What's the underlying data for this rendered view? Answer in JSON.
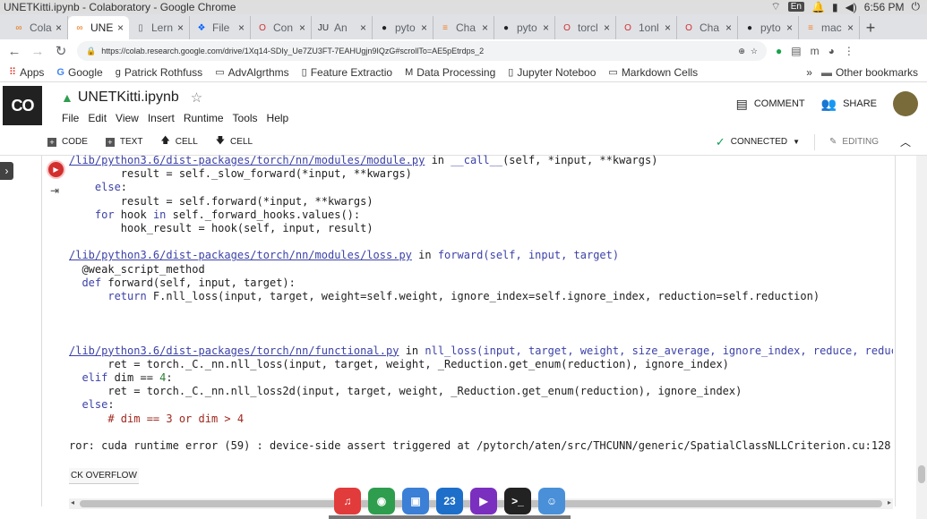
{
  "os": {
    "window_title": "UNETKitti.ipynb - Colaboratory - Google Chrome",
    "lang": "En",
    "clock": "6:56 PM"
  },
  "tabs": [
    {
      "icon": "colab",
      "label": "Cola",
      "active": false
    },
    {
      "icon": "colab",
      "label": "UNE",
      "active": true
    },
    {
      "icon": "doc",
      "label": "Lern",
      "active": false
    },
    {
      "icon": "dropbox",
      "label": "File",
      "active": false
    },
    {
      "icon": "opera",
      "label": "Con",
      "active": false
    },
    {
      "icon": "jupyter",
      "label": "An",
      "active": false
    },
    {
      "icon": "github",
      "label": "pyto",
      "active": false
    },
    {
      "icon": "stack",
      "label": "Cha",
      "active": false
    },
    {
      "icon": "github",
      "label": "pyto",
      "active": false
    },
    {
      "icon": "opera",
      "label": "torcl",
      "active": false
    },
    {
      "icon": "opera",
      "label": "1onl",
      "active": false
    },
    {
      "icon": "opera",
      "label": "Cha",
      "active": false
    },
    {
      "icon": "github",
      "label": "pyto",
      "active": false
    },
    {
      "icon": "stack",
      "label": "mac",
      "active": false
    }
  ],
  "address": {
    "url": "https://colab.research.google.com/drive/1Xq14-SDIy_Ue7ZU3FT-7EAHUgjn9IQzG#scrollTo=AE5pEtrdps_2"
  },
  "bookmarks": [
    {
      "icon": "apps",
      "label": "Apps"
    },
    {
      "icon": "google",
      "label": "Google"
    },
    {
      "icon": "g",
      "label": "Patrick Rothfuss"
    },
    {
      "icon": "box",
      "label": "AdvAlgrthms"
    },
    {
      "icon": "doc",
      "label": "Feature Extractio"
    },
    {
      "icon": "m",
      "label": "Data Processing"
    },
    {
      "icon": "doc",
      "label": "Jupyter Noteboo"
    },
    {
      "icon": "box",
      "label": "Markdown Cells"
    }
  ],
  "bookmarks_more": "»",
  "other_bookmarks": "Other bookmarks",
  "colab": {
    "logo": "CO",
    "notebook_title": "UNETKitti.ipynb",
    "menu": [
      "File",
      "Edit",
      "View",
      "Insert",
      "Runtime",
      "Tools",
      "Help"
    ],
    "comment": "COMMENT",
    "share": "SHARE"
  },
  "toolbar": {
    "code": "CODE",
    "text": "TEXT",
    "cell_up": "CELL",
    "cell_down": "CELL",
    "connected": "CONNECTED",
    "editing": "EDITING"
  },
  "output": {
    "lines": [
      [
        {
          "c": "lnk",
          "t": "/lib/python3.6/dist-packages/torch/nn/modules/module.py"
        },
        {
          "c": "",
          "t": " in "
        },
        {
          "c": "fn",
          "t": "__call__"
        },
        {
          "c": "",
          "t": "(self, *input, **kwargs)"
        }
      ],
      [
        {
          "c": "",
          "t": "        result = self._slow_forward(*input, **kwargs)"
        }
      ],
      [
        {
          "c": "kw",
          "t": "    else"
        },
        {
          "c": "",
          "t": ":"
        }
      ],
      [
        {
          "c": "",
          "t": "        result = self.forward(*input, **kwargs)"
        }
      ],
      [
        {
          "c": "kw",
          "t": "    for"
        },
        {
          "c": "",
          "t": " hook "
        },
        {
          "c": "kw",
          "t": "in"
        },
        {
          "c": "",
          "t": " self._forward_hooks.values():"
        }
      ],
      [
        {
          "c": "",
          "t": "        hook_result = hook(self, input, result)"
        }
      ],
      [
        {
          "c": "",
          "t": ""
        }
      ],
      [
        {
          "c": "lnk",
          "t": "/lib/python3.6/dist-packages/torch/nn/modules/loss.py"
        },
        {
          "c": "",
          "t": " in "
        },
        {
          "c": "fn",
          "t": "forward(self, input, target)"
        }
      ],
      [
        {
          "c": "",
          "t": "  @weak_script_method"
        }
      ],
      [
        {
          "c": "kw",
          "t": "  def"
        },
        {
          "c": "",
          "t": " forward(self, input, target):"
        }
      ],
      [
        {
          "c": "kw",
          "t": "      return"
        },
        {
          "c": "",
          "t": " F.nll_loss(input, target, weight=self.weight, ignore_index=self.ignore_index, reduction=self.reduction)"
        }
      ],
      [
        {
          "c": "",
          "t": ""
        }
      ],
      [
        {
          "c": "",
          "t": ""
        }
      ],
      [
        {
          "c": "",
          "t": ""
        }
      ],
      [
        {
          "c": "lnk",
          "t": "/lib/python3.6/dist-packages/torch/nn/functional.py"
        },
        {
          "c": "",
          "t": " in "
        },
        {
          "c": "fn",
          "t": "nll_loss(input, target, weight, size_average, ignore_index, reduce, reducti"
        }
      ],
      [
        {
          "c": "",
          "t": "      ret = torch._C._nn.nll_loss(input, target, weight, _Reduction.get_enum(reduction), ignore_index)"
        }
      ],
      [
        {
          "c": "kw",
          "t": "  elif"
        },
        {
          "c": "",
          "t": " dim == "
        },
        {
          "c": "num",
          "t": "4"
        },
        {
          "c": "",
          "t": ":"
        }
      ],
      [
        {
          "c": "",
          "t": "      ret = torch._C._nn.nll_loss2d(input, target, weight, _Reduction.get_enum(reduction), ignore_index)"
        }
      ],
      [
        {
          "c": "kw",
          "t": "  else"
        },
        {
          "c": "",
          "t": ":"
        }
      ],
      [
        {
          "c": "com",
          "t": "      # dim == 3 or dim > 4"
        }
      ],
      [
        {
          "c": "",
          "t": ""
        }
      ],
      [
        {
          "c": "",
          "t": "ror: cuda runtime error (59) : device-side assert triggered at /pytorch/aten/src/THCUNN/generic/SpatialClassNLLCriterion.cu:128"
        }
      ]
    ],
    "stack_overflow": "CK OVERFLOW"
  },
  "dock": [
    {
      "name": "music-app-icon",
      "color": "#e23b3b",
      "glyph": "♫"
    },
    {
      "name": "chrome-app-icon",
      "color": "#2e9d4e",
      "glyph": "◉"
    },
    {
      "name": "photos-app-icon",
      "color": "#3b7fd6",
      "glyph": "▣"
    },
    {
      "name": "calendar-app-icon",
      "color": "#1e6fc9",
      "glyph": "23"
    },
    {
      "name": "video-app-icon",
      "color": "#7b2fbf",
      "glyph": "▶"
    },
    {
      "name": "terminal-app-icon",
      "color": "#222222",
      "glyph": ">_"
    },
    {
      "name": "finder-app-icon",
      "color": "#4a90d9",
      "glyph": "☺"
    }
  ]
}
